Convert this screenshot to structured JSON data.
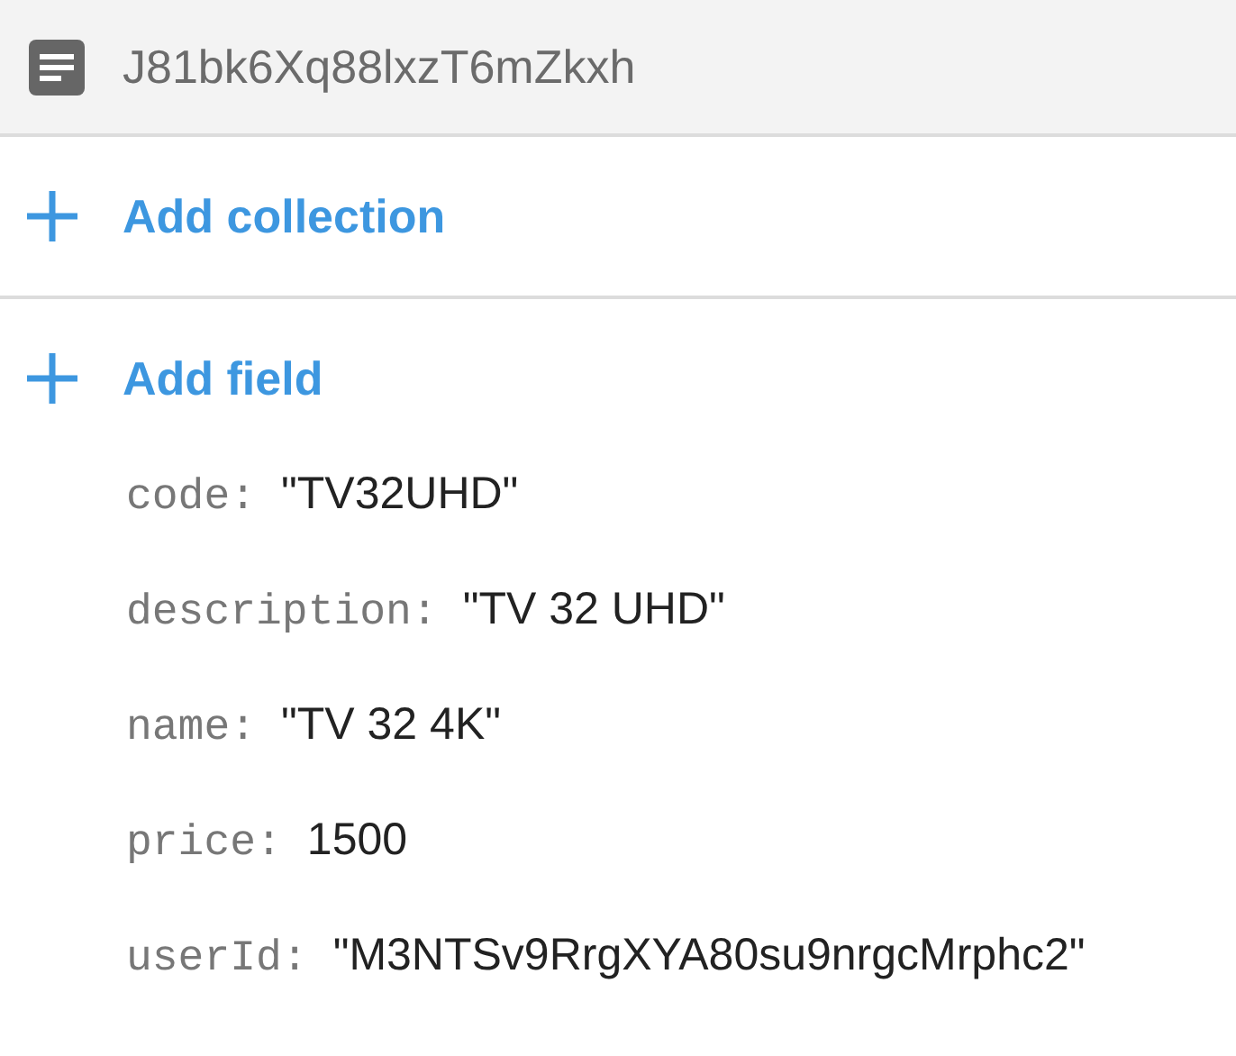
{
  "document": {
    "id": "J81bk6Xq88lxzT6mZkxh"
  },
  "actions": [
    {
      "label": "Add collection"
    },
    {
      "label": "Add field"
    }
  ],
  "fields": [
    {
      "key": "code:",
      "value": "\"TV32UHD\""
    },
    {
      "key": "description:",
      "value": "\"TV 32 UHD\""
    },
    {
      "key": "name:",
      "value": "\"TV 32 4K\""
    },
    {
      "key": "price:",
      "value": "1500"
    },
    {
      "key": "userId:",
      "value": "\"M3NTSv9RrgXYA80su9nrgcMrphc2\""
    }
  ]
}
